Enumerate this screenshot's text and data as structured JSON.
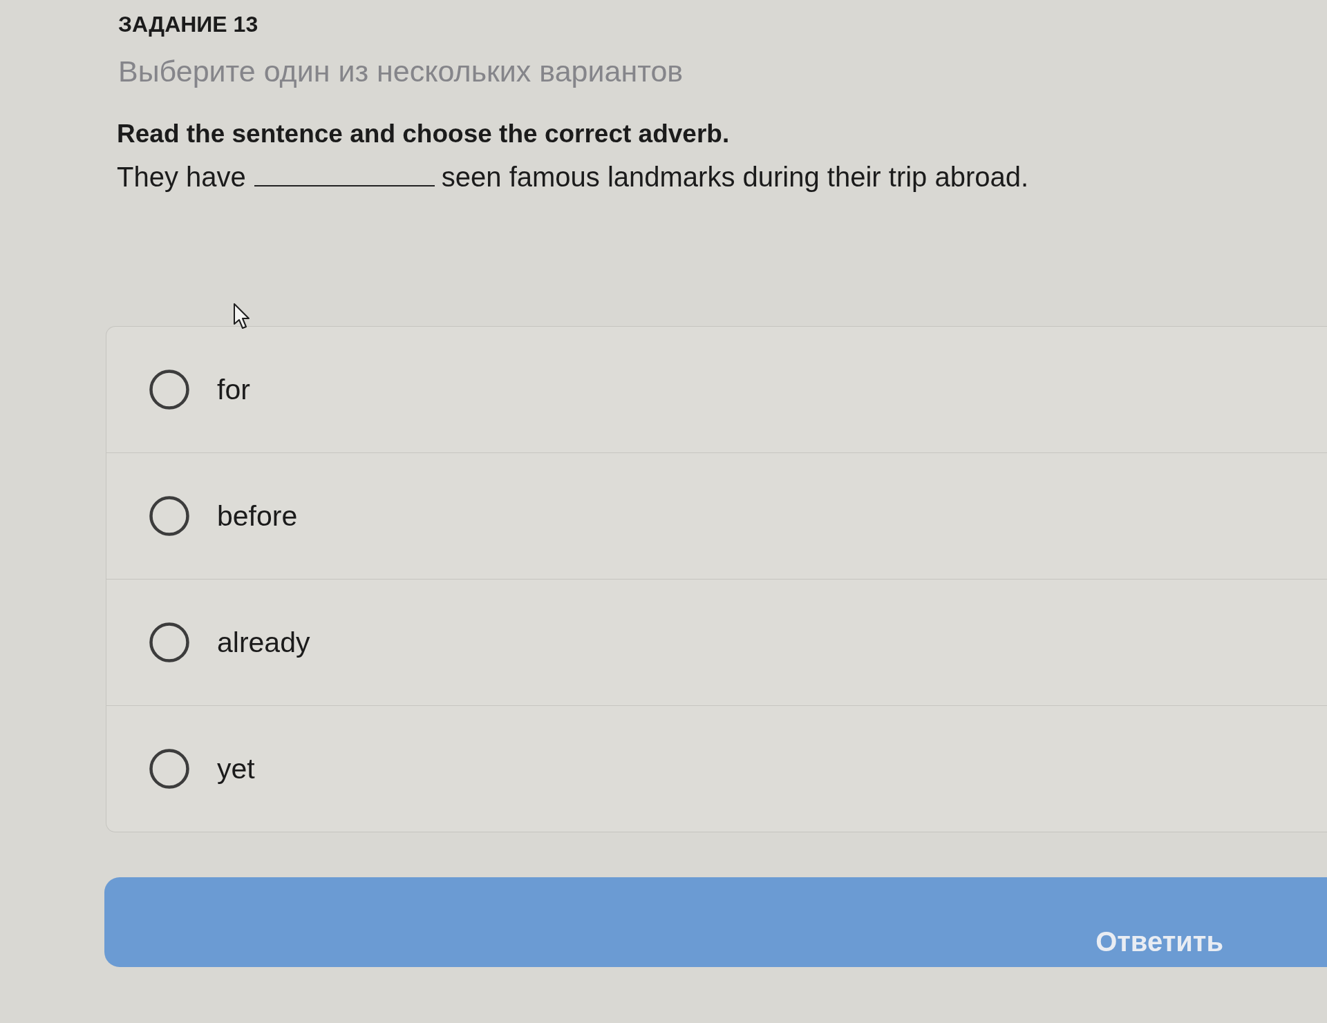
{
  "task": {
    "title": "ЗАДАНИЕ 13",
    "subtitle": "Выберите один из нескольких вариантов"
  },
  "question": {
    "instruction": "Read the sentence and choose the correct adverb.",
    "sentence_start": "They have",
    "sentence_end": "seen famous landmarks during their trip abroad."
  },
  "options": [
    {
      "label": "for",
      "selected": false
    },
    {
      "label": "before",
      "selected": false
    },
    {
      "label": "already",
      "selected": false
    },
    {
      "label": "yet",
      "selected": false
    }
  ],
  "submit_button": {
    "label": "Ответить"
  }
}
